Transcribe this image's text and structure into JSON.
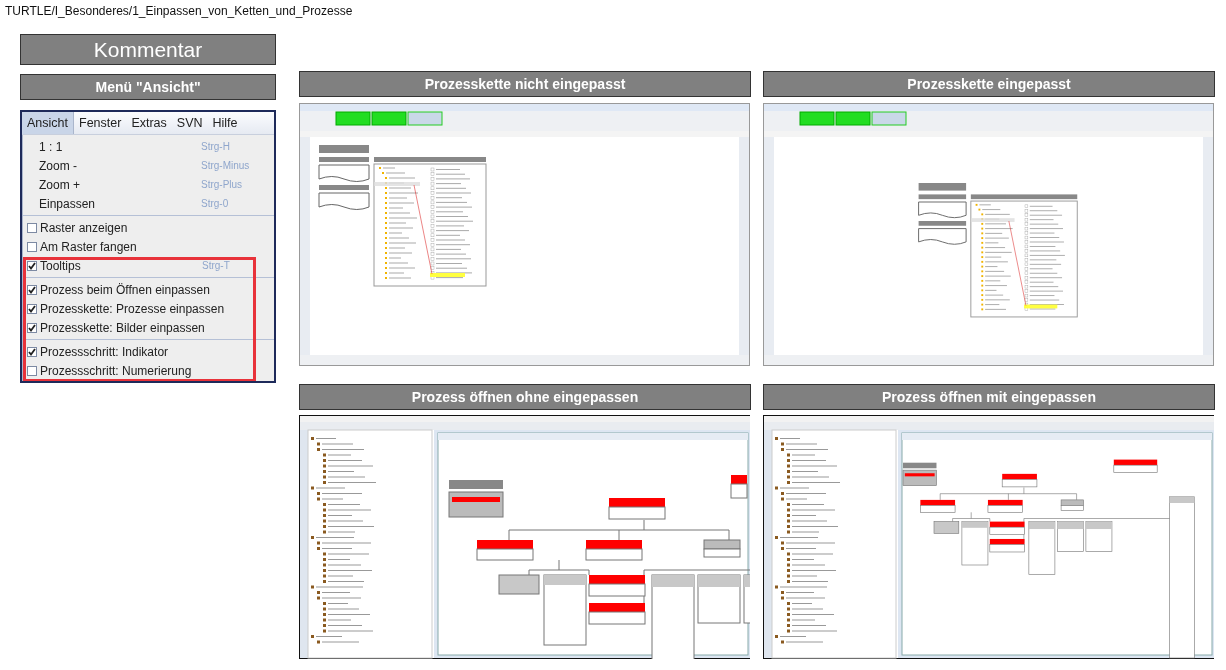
{
  "path": "TURTLE/I_Besonderes/1_Einpassen_von_Ketten_und_Prozesse",
  "title": "Kommentar",
  "menu_panel": {
    "heading": "Menü \"Ansicht\"",
    "menubar": [
      {
        "label": "Ansicht",
        "selected": true
      },
      {
        "label": "Fenster",
        "selected": false
      },
      {
        "label": "Extras",
        "selected": false
      },
      {
        "label": "SVN",
        "selected": false
      },
      {
        "label": "Hilfe",
        "selected": false
      }
    ],
    "groups": [
      {
        "items": [
          {
            "kind": "command",
            "label": "1 : 1",
            "shortcut": "Strg-H"
          },
          {
            "kind": "command",
            "label": "Zoom -",
            "shortcut": "Strg-Minus"
          },
          {
            "kind": "command",
            "label": "Zoom +",
            "shortcut": "Strg-Plus"
          },
          {
            "kind": "command",
            "label": "Einpassen",
            "shortcut": "Strg-0"
          }
        ]
      },
      {
        "items": [
          {
            "kind": "checkbox",
            "label": "Raster anzeigen",
            "checked": false
          },
          {
            "kind": "checkbox",
            "label": "Am Raster fangen",
            "checked": false
          },
          {
            "kind": "checkbox",
            "label": "Tooltips",
            "checked": true,
            "shortcut": "Strg-T"
          }
        ]
      },
      {
        "items": [
          {
            "kind": "checkbox",
            "label": "Prozess beim Öffnen einpassen",
            "checked": true
          },
          {
            "kind": "checkbox",
            "label": "Prozesskette: Prozesse einpassen",
            "checked": true
          },
          {
            "kind": "checkbox",
            "label": "Prozesskette: Bilder einpassen",
            "checked": true
          }
        ]
      },
      {
        "items": [
          {
            "kind": "checkbox",
            "label": "Prozessschritt: Indikator",
            "checked": true
          },
          {
            "kind": "checkbox",
            "label": "Prozessschritt: Numerierung",
            "checked": false
          }
        ]
      }
    ]
  },
  "examples": [
    {
      "heading": "Prozesskette nicht eingepasst",
      "kind": "chain_unfitted"
    },
    {
      "heading": "Prozesskette eingepasst",
      "kind": "chain_fitted"
    },
    {
      "heading": "Prozess öffnen ohne eingepassen",
      "kind": "process_unfitted"
    },
    {
      "heading": "Prozess öffnen mit eingepassen",
      "kind": "process_fitted"
    }
  ]
}
